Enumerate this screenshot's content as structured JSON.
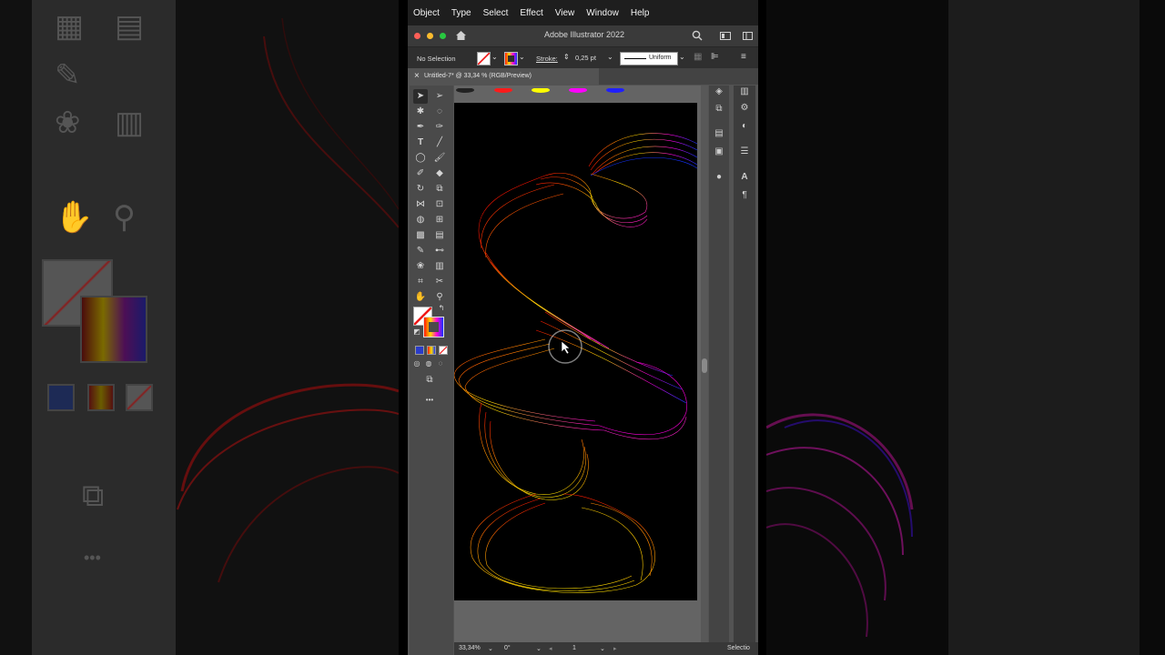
{
  "menu": [
    "Object",
    "Type",
    "Select",
    "Effect",
    "View",
    "Window",
    "Help"
  ],
  "window": {
    "title": "Adobe Illustrator 2022",
    "traffic_colors": [
      "#ff5f57",
      "#febc2e",
      "#28c840"
    ]
  },
  "control_bar": {
    "selection_status": "No Selection",
    "stroke_label": "Stroke:",
    "stroke_weight": "0,25 pt",
    "profile": "Uniform"
  },
  "document_tab": {
    "close": "×",
    "label": "Untitled-7* @ 33,34 % (RGB/Preview)"
  },
  "status_bar": {
    "zoom": "33,34%",
    "rotation": "0°",
    "artboard_number": "1",
    "tool_name": "Selectio"
  },
  "toolbar": {
    "more_label": "•••"
  },
  "artwork": {
    "swatch_colors": [
      "#222222",
      "#ff1a1a",
      "#ffff00",
      "#ff00ff",
      "#1f1fff"
    ],
    "gradient_colors": [
      "#ff1500",
      "#ffdf00",
      "#ff00dd",
      "#1433ff"
    ]
  }
}
